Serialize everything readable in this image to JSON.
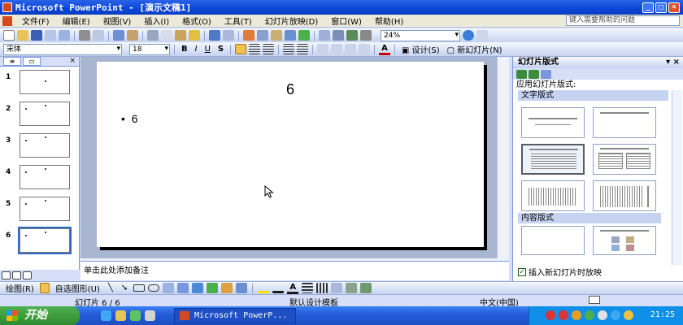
{
  "window": {
    "title": "Microsoft PowerPoint - [演示文稿1]",
    "helpbox_placeholder": "键入需要帮助的问题"
  },
  "menu": [
    "文件(F)",
    "编辑(E)",
    "视图(V)",
    "插入(I)",
    "格式(O)",
    "工具(T)",
    "幻灯片放映(D)",
    "窗口(W)",
    "帮助(H)"
  ],
  "toolbar": {
    "zoom": "24%",
    "font_name": "宋体",
    "font_size": "18",
    "bold": "B",
    "italic": "I",
    "underline": "U",
    "shadow": "S",
    "design_label": "设计(S)",
    "new_slide_label": "新幻灯片(N)"
  },
  "slides": {
    "numbers": [
      "1",
      "2",
      "3",
      "4",
      "5",
      "6"
    ],
    "selected": 6
  },
  "current_slide": {
    "title": "6",
    "bullet": "6"
  },
  "notes_placeholder": "单击此处添加备注",
  "task_pane": {
    "title": "幻灯片版式",
    "subtitle": "应用幻灯片版式:",
    "section_text_layouts": "文字版式",
    "section_content_layouts": "内容版式",
    "footer_checkbox": "插入新幻灯片时放映",
    "footer_checked": true
  },
  "drawing_toolbar": {
    "draw_label": "绘图(R)",
    "autoshapes_label": "自选图形(U)"
  },
  "statusbar": {
    "slide_position": "幻灯片 6 / 6",
    "design_template": "默认设计模板",
    "language": "中文(中国)"
  },
  "taskbar": {
    "start_label": "开始",
    "task_item": "Microsoft PowerP...",
    "clock": "21:25"
  }
}
